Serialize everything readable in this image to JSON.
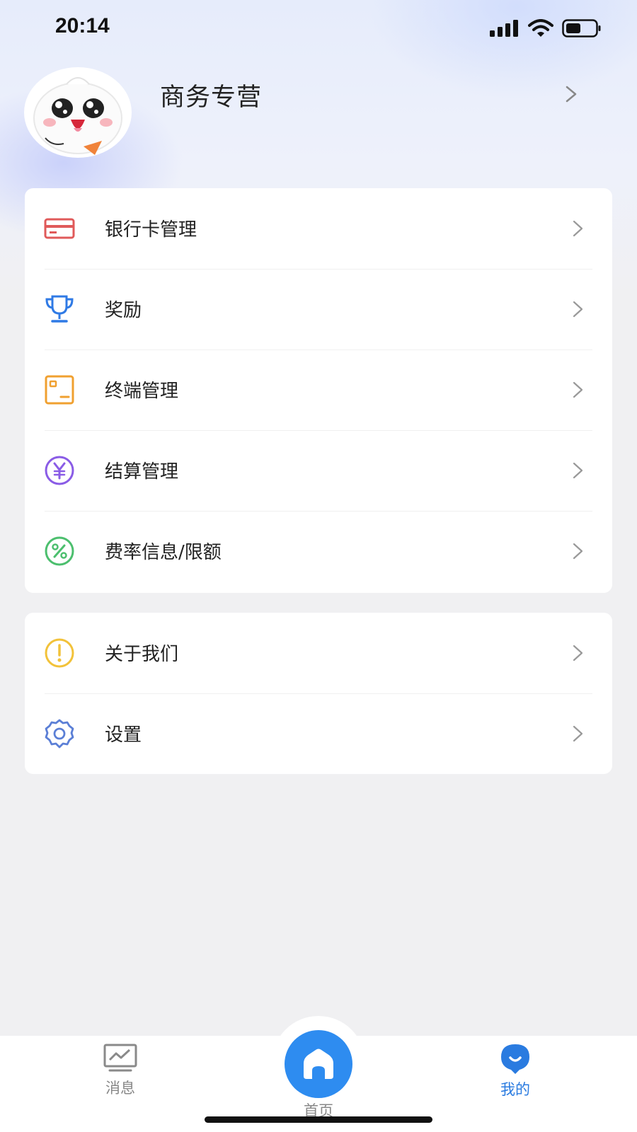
{
  "status_bar": {
    "time": "20:14"
  },
  "profile": {
    "name": "商务专营"
  },
  "menu_group_1": [
    {
      "key": "bank-card",
      "label": "银行卡管理",
      "icon": "bank-card-icon",
      "color": "#e05a5a"
    },
    {
      "key": "rewards",
      "label": "奖励",
      "icon": "trophy-icon",
      "color": "#2f7ae5"
    },
    {
      "key": "terminal",
      "label": "终端管理",
      "icon": "terminal-icon",
      "color": "#f0a030"
    },
    {
      "key": "settlement",
      "label": "结算管理",
      "icon": "yen-icon",
      "color": "#8a5ce6"
    },
    {
      "key": "rates",
      "label": "费率信息/限额",
      "icon": "percent-icon",
      "color": "#4cbf6e"
    }
  ],
  "menu_group_2": [
    {
      "key": "about",
      "label": "关于我们",
      "icon": "info-icon",
      "color": "#f2c23a"
    },
    {
      "key": "settings",
      "label": "设置",
      "icon": "gear-icon",
      "color": "#5b7fd6"
    }
  ],
  "tabbar": {
    "messages": "消息",
    "home": "首页",
    "mine": "我的",
    "active": "mine",
    "accent_color": "#2a7be0"
  }
}
